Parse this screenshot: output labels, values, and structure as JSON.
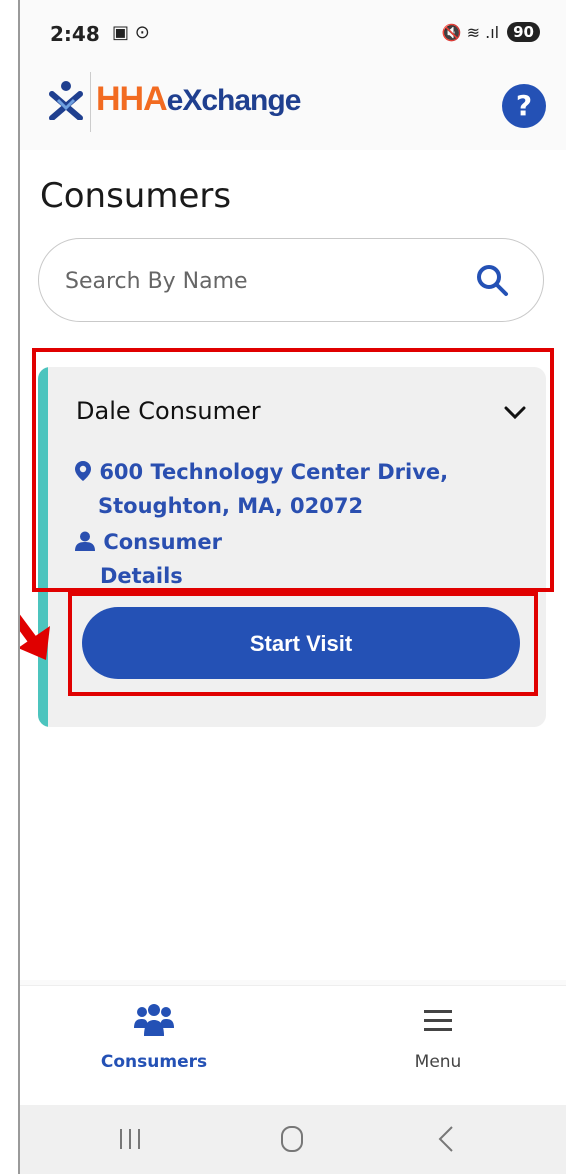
{
  "status_bar": {
    "time": "2:48",
    "left_icons": "▣ ⊙",
    "signal_icons": "🔇 ≋ .ıl",
    "battery": "90"
  },
  "header": {
    "logo_hha": "HHA",
    "logo_exchange": "eXchange",
    "help_label": "?"
  },
  "page": {
    "title": "Consumers"
  },
  "search": {
    "placeholder": "Search By Name",
    "value": ""
  },
  "consumer_card": {
    "name": "Dale Consumer",
    "address_line1": "600 Technology Center Drive,",
    "address_line2": "Stoughton, MA, 02072",
    "details_line1": "Consumer",
    "details_line2": "Details",
    "start_visit_label": "Start Visit"
  },
  "bottom_nav": {
    "consumers_label": "Consumers",
    "menu_label": "Menu"
  },
  "colors": {
    "primary": "#2451b5",
    "accent": "#4cc4be",
    "brand_orange": "#f26b21",
    "highlight": "#e00000"
  }
}
